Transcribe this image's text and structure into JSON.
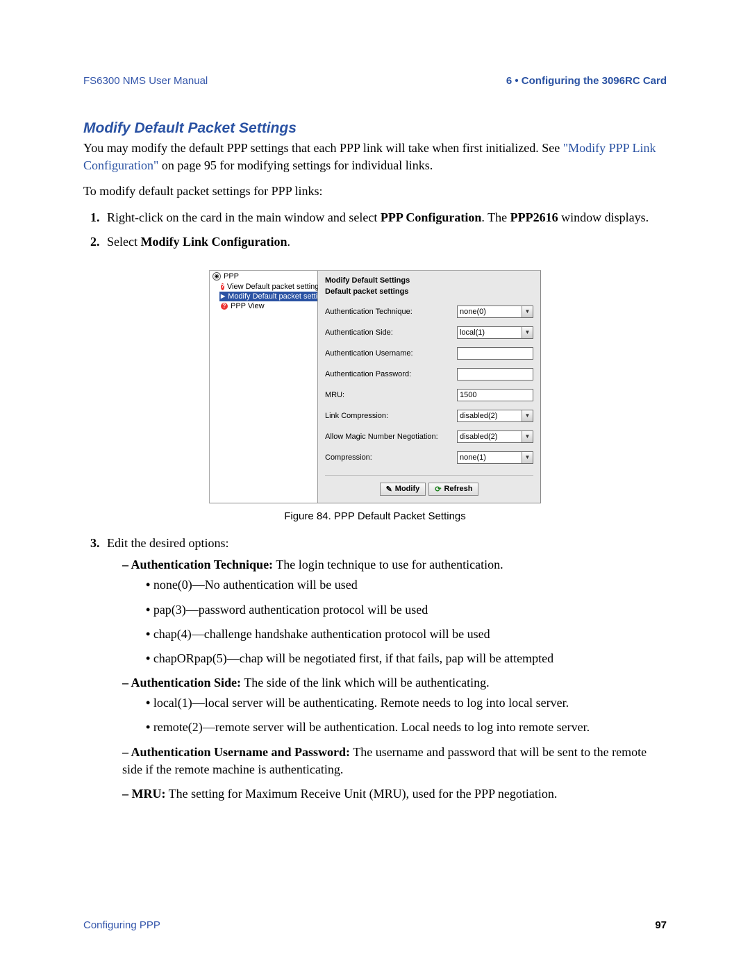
{
  "header": {
    "left": "FS6300 NMS User Manual",
    "right": "6 • Configuring the 3096RC Card"
  },
  "section_title": "Modify Default Packet Settings",
  "intro_1a": "You may modify the default PPP settings that each PPP link will take when first initialized. See ",
  "intro_link": "\"Modify PPP Link Configuration\"",
  "intro_1b": " on page 95 for modifying settings for individual links.",
  "intro_2": "To modify default packet settings for PPP links:",
  "step1_a": "Right-click on the card in the main window and select ",
  "step1_bold1": "PPP Configuration",
  "step1_b": ". The ",
  "step1_bold2": "PPP2616",
  "step1_c": " window displays.",
  "step2_a": "Select ",
  "step2_bold": "Modify Link Configuration",
  "step2_b": ".",
  "tree": {
    "root": "PPP",
    "items": [
      "View Default packet settings",
      "Modify Default packet settings",
      "PPP View"
    ],
    "selected_index": 1
  },
  "form": {
    "title": "Modify Default Settings",
    "subtitle": "Default packet settings",
    "fields": [
      {
        "label": "Authentication Technique:",
        "value": "none(0)",
        "type": "select"
      },
      {
        "label": "Authentication Side:",
        "value": "local(1)",
        "type": "select"
      },
      {
        "label": "Authentication Username:",
        "value": "",
        "type": "text"
      },
      {
        "label": "Authentication Password:",
        "value": "",
        "type": "text"
      },
      {
        "label": "MRU:",
        "value": "1500",
        "type": "text"
      },
      {
        "label": "Link Compression:",
        "value": "disabled(2)",
        "type": "select"
      },
      {
        "label": "Allow Magic Number Negotiation:",
        "value": "disabled(2)",
        "type": "select"
      },
      {
        "label": "Compression:",
        "value": "none(1)",
        "type": "select"
      }
    ],
    "buttons": {
      "modify": "Modify",
      "refresh": "Refresh"
    }
  },
  "figure_caption": "Figure 84. PPP Default Packet Settings",
  "step3_intro": "Edit the desired options:",
  "opt_auth_tech_label": "Authentication Technique:",
  "opt_auth_tech_text": " The login technique to use for authentication.",
  "auth_tech_items": [
    "none(0)—No authentication will be used",
    "pap(3)—password authentication protocol will be used",
    "chap(4)—challenge handshake authentication protocol will be used",
    "chapORpap(5)—chap will be negotiated first, if that fails, pap will be attempted"
  ],
  "opt_auth_side_label": "Authentication Side:",
  "opt_auth_side_text": " The side of the link which will be authenticating.",
  "auth_side_items": [
    "local(1)—local server will be authenticating. Remote needs to log into local server.",
    "remote(2)—remote server will be authentication. Local needs to log into remote server."
  ],
  "opt_userpass_label": "Authentication Username and Password:",
  "opt_userpass_text": " The username and password that will be sent to the remote side if the remote machine is authenticating.",
  "opt_mru_label": "MRU:",
  "opt_mru_text": " The setting for Maximum Receive Unit (MRU), used for the PPP negotiation.",
  "footer": {
    "left": "Configuring PPP",
    "right": "97"
  }
}
